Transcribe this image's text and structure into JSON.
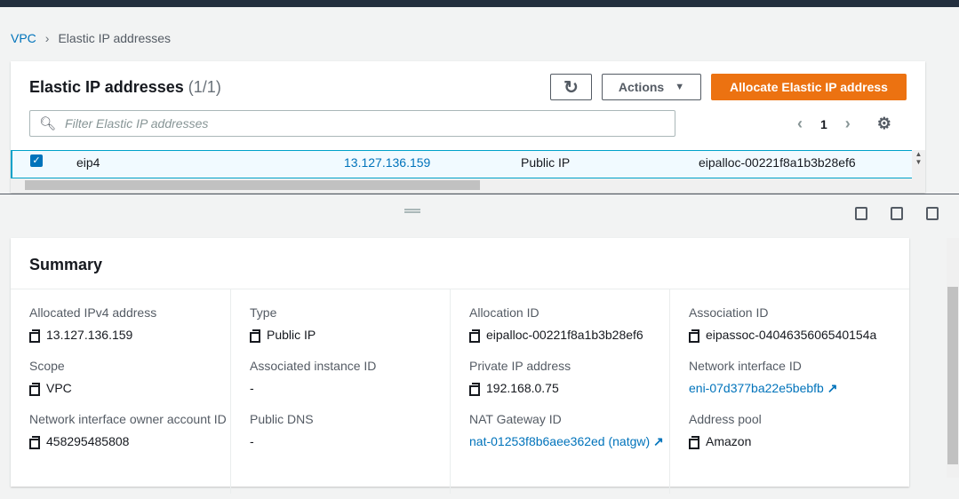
{
  "breadcrumb": {
    "root": "VPC",
    "current": "Elastic IP addresses"
  },
  "panel": {
    "title": "Elastic IP addresses",
    "count": "(1/1)",
    "actions_label": "Actions",
    "allocate_label": "Allocate Elastic IP address",
    "filter_placeholder": "Filter Elastic IP addresses",
    "page": "1"
  },
  "row": {
    "name": "eip4",
    "ip": "13.127.136.159",
    "type": "Public IP",
    "allocation": "eipalloc-00221f8a1b3b28ef6"
  },
  "summary": {
    "title": "Summary",
    "cols": [
      [
        {
          "label": "Allocated IPv4 address",
          "value": "13.127.136.159",
          "copy": true
        },
        {
          "label": "Scope",
          "value": "VPC",
          "copy": true
        },
        {
          "label": "Network interface owner account ID",
          "value": "458295485808",
          "copy": true
        }
      ],
      [
        {
          "label": "Type",
          "value": "Public IP",
          "copy": true
        },
        {
          "label": "Associated instance ID",
          "value": "-"
        },
        {
          "label": "Public DNS",
          "value": "-"
        }
      ],
      [
        {
          "label": "Allocation ID",
          "value": "eipalloc-00221f8a1b3b28ef6",
          "copy": true
        },
        {
          "label": "Private IP address",
          "value": "192.168.0.75",
          "copy": true
        },
        {
          "label": "NAT Gateway ID",
          "value": "nat-01253f8b6aee362ed (natgw)",
          "link": true
        }
      ],
      [
        {
          "label": "Association ID",
          "value": "eipassoc-0404635606540154a",
          "copy": true
        },
        {
          "label": "Network interface ID",
          "value": "eni-07d377ba22e5bebfb",
          "link": true
        },
        {
          "label": "Address pool",
          "value": "Amazon",
          "copy": true
        }
      ]
    ]
  }
}
